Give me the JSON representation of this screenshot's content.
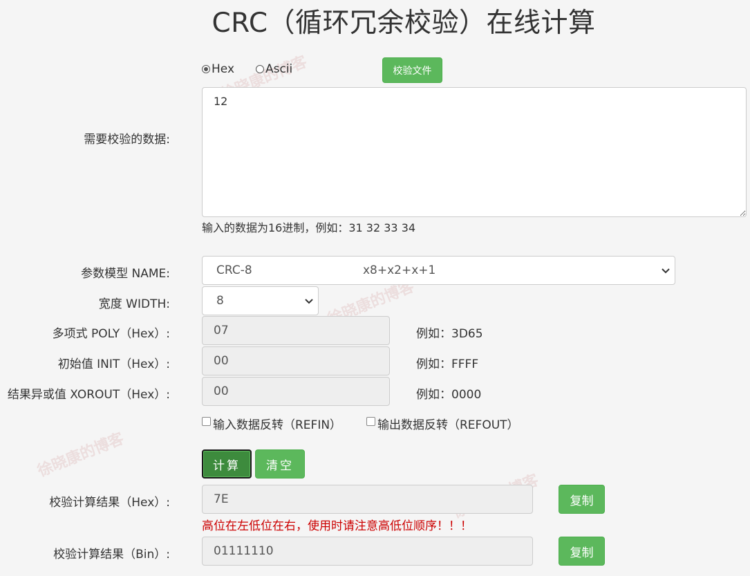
{
  "title": "CRC（循环冗余校验）在线计算",
  "mode": {
    "hex_label": "Hex",
    "ascii_label": "Ascii",
    "selected": "Hex"
  },
  "file_button": "校验文件",
  "data_field": {
    "label": "需要校验的数据:",
    "value": "12",
    "hint": "输入的数据为16进制，例如：31 32 33 34"
  },
  "model": {
    "label": "参数模型 NAME:",
    "name": "CRC-8",
    "poly_expr": "x8+x2+x+1"
  },
  "width": {
    "label": "宽度 WIDTH:",
    "value": "8"
  },
  "poly": {
    "label": "多项式 POLY（Hex）:",
    "value": "07",
    "example": "例如：3D65"
  },
  "init": {
    "label": "初始值 INIT（Hex）:",
    "value": "00",
    "example": "例如：FFFF"
  },
  "xorout": {
    "label": "结果异或值 XOROUT（Hex）:",
    "value": "00",
    "example": "例如：0000"
  },
  "refin_label": "输入数据反转（REFIN）",
  "refout_label": "输出数据反转（REFOUT）",
  "calc_button": "计算",
  "clear_button": "清空",
  "result_hex": {
    "label": "校验计算结果（Hex）:",
    "value": "7E",
    "copy": "复制",
    "warning": "高位在左低位在右，使用时请注意高低位顺序！！！"
  },
  "result_bin": {
    "label": "校验计算结果（Bin）:",
    "value": "01111110",
    "copy": "复制"
  },
  "watermark": "徐晓康的博客"
}
